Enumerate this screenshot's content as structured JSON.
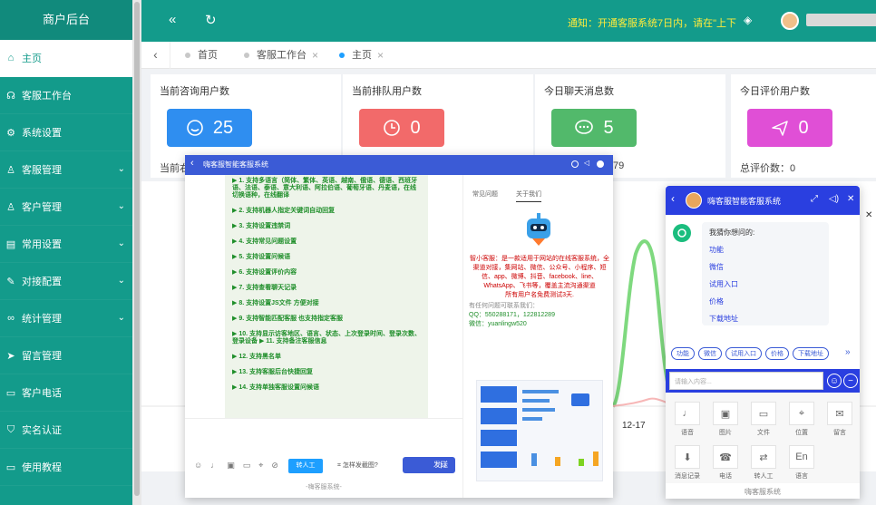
{
  "sidebar": {
    "brand": "商户后台",
    "items": [
      {
        "label": "主页",
        "icon": "home-icon",
        "active": true
      },
      {
        "label": "客服工作台",
        "icon": "headset-icon"
      },
      {
        "label": "系统设置",
        "icon": "gear-icon"
      },
      {
        "label": "客服管理",
        "icon": "user-icon",
        "expand": true
      },
      {
        "label": "客户管理",
        "icon": "user-icon",
        "expand": true
      },
      {
        "label": "常用设置",
        "icon": "doc-icon",
        "expand": true
      },
      {
        "label": "对接配置",
        "icon": "edit-icon",
        "expand": true
      },
      {
        "label": "统计管理",
        "icon": "link-icon",
        "expand": true
      },
      {
        "label": "留言管理",
        "icon": "send-icon"
      },
      {
        "label": "客户电话",
        "icon": "window-icon"
      },
      {
        "label": "实名认证",
        "icon": "shield-icon"
      },
      {
        "label": "使用教程",
        "icon": "window-icon"
      }
    ]
  },
  "header": {
    "notice": "通知：开通客服系统7日内，请在\"上下"
  },
  "tabs": [
    {
      "label": "首页",
      "closable": false
    },
    {
      "label": "客服工作台",
      "closable": true
    },
    {
      "label": "主页",
      "closable": true,
      "active": true
    }
  ],
  "cards": [
    {
      "title": "当前咨询用户数",
      "value": "25",
      "color": "#2f8ef0",
      "icon": "smile-icon",
      "footer": "当前右"
    },
    {
      "title": "当前排队用户数",
      "value": "0",
      "color": "#f26a6a",
      "icon": "clock-icon",
      "footer": ""
    },
    {
      "title": "今日聊天消息数",
      "value": "5",
      "color": "#52b96b",
      "icon": "chat-icon",
      "footer": "79"
    },
    {
      "title": "今日评价用户数",
      "value": "0",
      "color": "#e04fd6",
      "icon": "send-icon",
      "footer": "总评价数：0"
    }
  ],
  "chart": {
    "xtick": "12-17"
  },
  "window_main": {
    "title": "嗨客服智能客服系统",
    "features": [
      "▶ 1. 支持多语言（简体、繁体、英语、越南、俄语、德语、西班牙语、法语、泰语、意大利语、阿拉伯语、葡萄牙语、丹麦语，在线切换语种，在线翻译",
      "▶ 2. 支持机器人指定关键词自动回复",
      "▶ 3. 支持设置违禁词",
      "▶ 4. 支持常见问题设置",
      "▶ 5. 支持设置问候语",
      "▶ 6. 支持设置评价内容",
      "▶ 7. 支持查看聊天记录",
      "▶ 8. 支持设置JS文件 方便对接",
      "▶ 9. 支持智能匹配客服 也支持指定客服",
      "▶ 10. 支持显示访客地区、语言、状态、上次登录时间、登录次数、登录设备 ▶ 11. 支持备注客服信息",
      "▶ 12. 支持黑名单",
      "▶ 13. 支持客服后台快捷回复",
      "▶ 14. 支持单独客服设置问候语"
    ],
    "transfer_btn": "转人工",
    "how_to": "怎样发截图?",
    "send_btn": "发送",
    "footer": "-嗨客服系统-",
    "right_tabs": [
      "常见问题",
      "关于我们"
    ],
    "desc": "智小客服：是一款适用于网站的在线客服系统，全渠道对接，集网站、微信、公众号、小程序、短信、app、微博、抖音、facebook、line、WhatsApp、飞书等，覆盖主流沟通渠道",
    "desc2": "所有用户名免费测试3天.",
    "contact_hint": "有任何问题可联系我们：",
    "qq": "QQ：550288171，122812289",
    "wechat": "微信：yuanlingw520"
  },
  "window_mobile": {
    "title": "嗨客服智能客服系统",
    "greet": "我猜你想问的:",
    "links": [
      "功能",
      "微信",
      "试用入口",
      "价格",
      "下载地址"
    ],
    "chips": [
      "功能",
      "微信",
      "试用入口",
      "价格",
      "下载地址"
    ],
    "input_placeholder": "请输入内容...",
    "tools": [
      {
        "label": "语音",
        "icon": "mic-icon"
      },
      {
        "label": "图片",
        "icon": "image-icon"
      },
      {
        "label": "文件",
        "icon": "folder-icon"
      },
      {
        "label": "位置",
        "icon": "location-icon"
      },
      {
        "label": "留言",
        "icon": "message-icon"
      },
      {
        "label": "消息记录",
        "icon": "download-icon"
      },
      {
        "label": "电话",
        "icon": "phone-icon"
      },
      {
        "label": "转人工",
        "icon": "transfer-icon"
      },
      {
        "label": "语言",
        "icon": "language-icon"
      }
    ],
    "footer": "嗨客服系统"
  }
}
